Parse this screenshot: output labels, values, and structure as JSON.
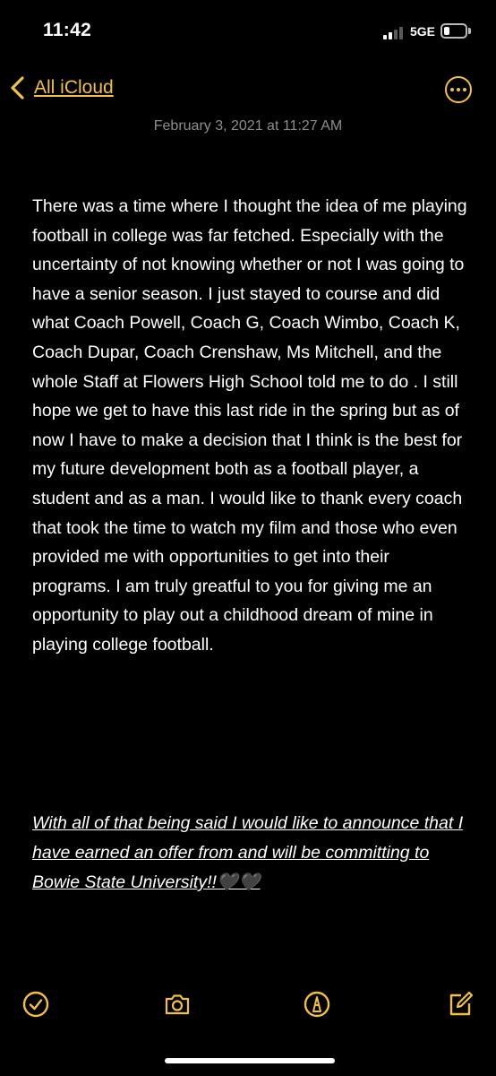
{
  "status_bar": {
    "time": "11:42",
    "network": "5GE",
    "signal_bars_active": 2,
    "signal_bars_total": 4,
    "battery_level": 0.25
  },
  "nav": {
    "back_label": "All iCloud",
    "back_icon": "chevron-left-icon",
    "more_icon": "ellipsis-circle-icon"
  },
  "note": {
    "date": "February 3, 2021 at 11:27 AM",
    "body": "There was a time where I thought the idea of me playing football in college was far fetched. Especially with the uncertainty of not knowing whether or not I was going to have a senior season. I just stayed to course and did what Coach Powell, Coach G, Coach Wimbo, Coach K, Coach Dupar, Coach Crenshaw, Ms Mitchell, and the whole Staff at Flowers High School told me to do . I still hope we get to have this last ride in the spring but as of now I have to make a decision that I think is the best for my future development both as a football player, a student and as a man. I would like to thank every coach that took the time to watch my film and those who even provided me with opportunities to get into their programs. I am truly greatful to you for giving me an opportunity to play out a childhood dream of mine in playing college football.",
    "closing": "With all of that being said I would like to announce that I have earned an offer from and will be committing to Bowie State University!!🖤🖤"
  },
  "toolbar": {
    "items": [
      "checklist-icon",
      "camera-icon",
      "markup-icon",
      "compose-icon"
    ]
  },
  "colors": {
    "accent": "#f2c140",
    "background": "#000000",
    "text": "#ffffff",
    "secondary_text": "#8d8d93"
  }
}
